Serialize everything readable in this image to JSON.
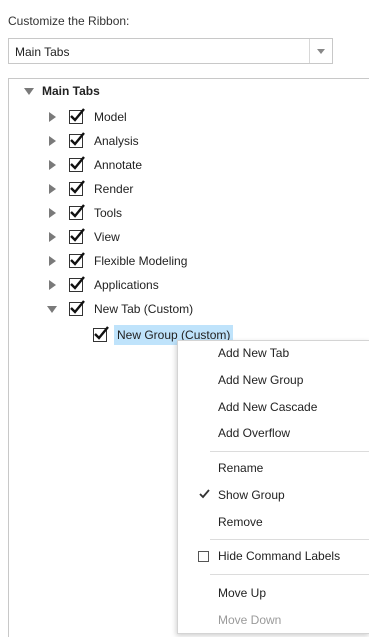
{
  "header": {
    "title": "Customize the Ribbon:"
  },
  "combo": {
    "value": "Main Tabs"
  },
  "tree": {
    "root": "Main Tabs",
    "tabs": [
      "Model",
      "Analysis",
      "Annotate",
      "Render",
      "Tools",
      "View",
      "Flexible Modeling",
      "Applications"
    ],
    "custom_tab": "New Tab (Custom)",
    "custom_group": "New Group (Custom)"
  },
  "context_menu": {
    "add_new_tab": "Add New Tab",
    "add_new_group": "Add New Group",
    "add_new_cascade": "Add New Cascade",
    "add_overflow": "Add Overflow",
    "rename": "Rename",
    "show_group": "Show Group",
    "remove": "Remove",
    "hide_command_labels": "Hide Command Labels",
    "move_up": "Move Up",
    "move_down": "Move Down"
  }
}
